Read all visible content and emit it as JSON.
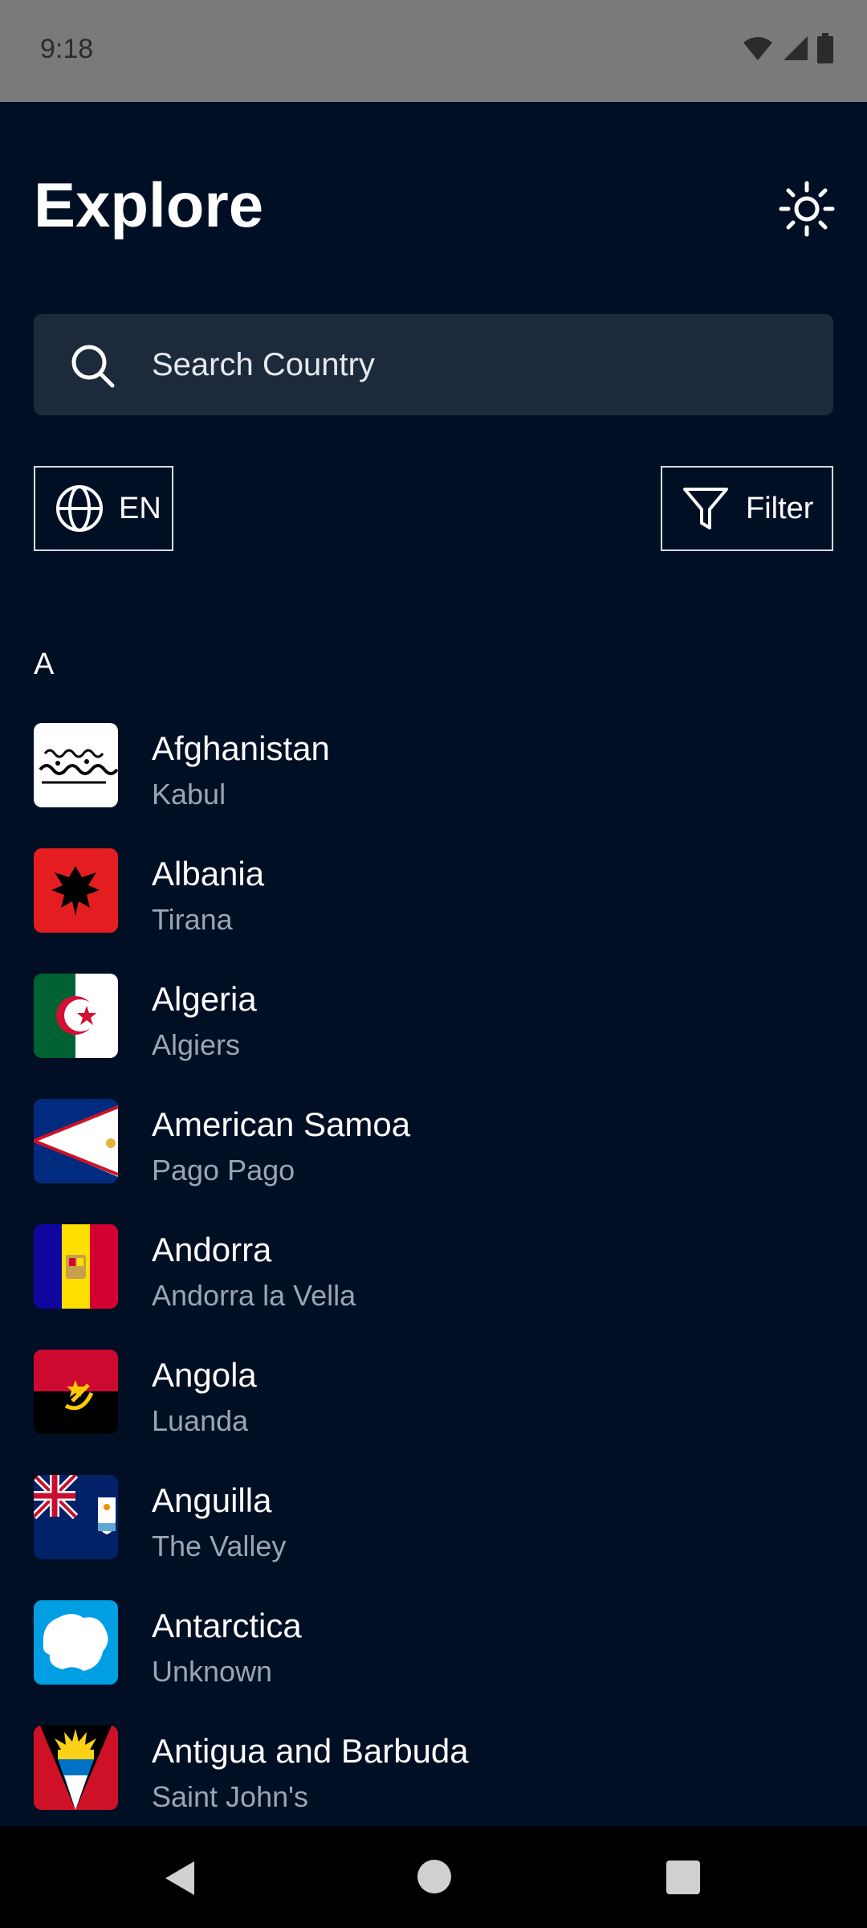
{
  "status_bar": {
    "time": "9:18"
  },
  "header": {
    "title": "Explore"
  },
  "search": {
    "placeholder": "Search Country"
  },
  "language_button": {
    "label": "EN"
  },
  "filter_button": {
    "label": "Filter"
  },
  "section": {
    "letter": "A"
  },
  "countries": [
    {
      "name": "Afghanistan",
      "capital": "Kabul",
      "flag": "afghanistan-flag"
    },
    {
      "name": "Albania",
      "capital": "Tirana",
      "flag": "albania-flag"
    },
    {
      "name": "Algeria",
      "capital": "Algiers",
      "flag": "algeria-flag"
    },
    {
      "name": "American Samoa",
      "capital": "Pago Pago",
      "flag": "american-samoa-flag"
    },
    {
      "name": "Andorra",
      "capital": "Andorra la Vella",
      "flag": "andorra-flag"
    },
    {
      "name": "Angola",
      "capital": "Luanda",
      "flag": "angola-flag"
    },
    {
      "name": "Anguilla",
      "capital": "The Valley",
      "flag": "anguilla-flag"
    },
    {
      "name": "Antarctica",
      "capital": "Unknown",
      "flag": "antarctica-flag"
    },
    {
      "name": "Antigua and Barbuda",
      "capital": "Saint John's",
      "flag": "antigua-and-barbuda-flag"
    }
  ],
  "colors": {
    "background": "#000F24",
    "search_bg": "#1d2a3c",
    "subtext": "#9aa5b4"
  }
}
